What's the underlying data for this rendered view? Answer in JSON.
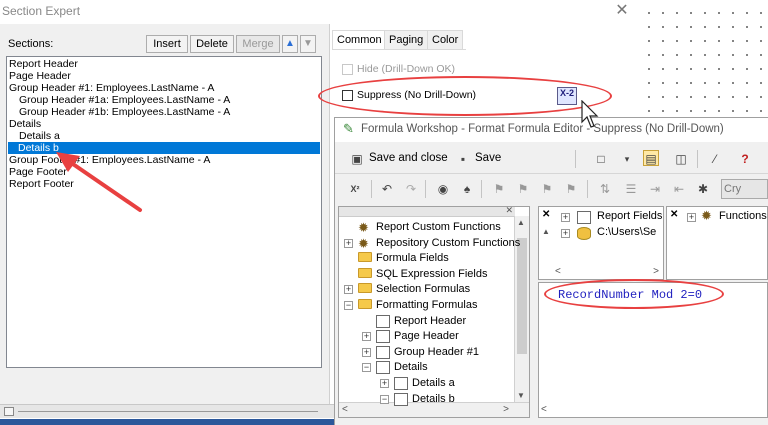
{
  "section_expert": {
    "title": "Section Expert",
    "sections_label": "Sections:",
    "buttons": {
      "insert": "Insert",
      "delete": "Delete",
      "merge": "Merge"
    },
    "sections": [
      {
        "label": "Report Header",
        "indent": 0,
        "selected": false
      },
      {
        "label": "Page Header",
        "indent": 0,
        "selected": false
      },
      {
        "label": "Group Header #1: Employees.LastName - A",
        "indent": 0,
        "selected": false
      },
      {
        "label": "Group Header #1a: Employees.LastName - A",
        "indent": 1,
        "selected": false
      },
      {
        "label": "Group Header #1b: Employees.LastName - A",
        "indent": 1,
        "selected": false
      },
      {
        "label": "Details",
        "indent": 0,
        "selected": false
      },
      {
        "label": "Details a",
        "indent": 1,
        "selected": false
      },
      {
        "label": "Details b",
        "indent": 1,
        "selected": true
      },
      {
        "label": "Group Footer #1: Employees.LastName - A",
        "indent": 0,
        "selected": false
      },
      {
        "label": "Page Footer",
        "indent": 0,
        "selected": false
      },
      {
        "label": "Report Footer",
        "indent": 0,
        "selected": false
      }
    ],
    "tabs": {
      "common": "Common",
      "paging": "Paging",
      "color": "Color"
    },
    "options": {
      "hide_label": "Hide (Drill-Down OK)",
      "suppress_label": "Suppress (No Drill-Down)",
      "formula_button": "X-2"
    }
  },
  "formula_workshop": {
    "title": "Formula Workshop - Format Formula Editor - Suppress (No Drill-Down)",
    "toolbar": {
      "save_close": "Save and close",
      "save": "Save",
      "syntax_partial": "Cry"
    },
    "tree": [
      {
        "label": "Report Custom Functions",
        "icon": "gear",
        "expander": ""
      },
      {
        "label": "Repository Custom Functions",
        "icon": "gear",
        "expander": "+"
      },
      {
        "label": "Formula Fields",
        "icon": "folder",
        "expander": ""
      },
      {
        "label": "SQL Expression Fields",
        "icon": "folder",
        "expander": ""
      },
      {
        "label": "Selection Formulas",
        "icon": "folder",
        "expander": "+"
      },
      {
        "label": "Formatting Formulas",
        "icon": "folder",
        "expander": "−"
      },
      {
        "label": "Report Header",
        "icon": "doc",
        "expander": ""
      },
      {
        "label": "Page Header",
        "icon": "doc",
        "expander": "+"
      },
      {
        "label": "Group Header #1",
        "icon": "doc",
        "expander": "+"
      },
      {
        "label": "Details",
        "icon": "doc",
        "expander": "−"
      },
      {
        "label": "Details a",
        "icon": "doc",
        "expander": "+"
      },
      {
        "label": "Details b",
        "icon": "doc",
        "expander": "−"
      }
    ],
    "fields": {
      "report_fields": "Report Fields",
      "path": "C:\\Users\\Se",
      "functions": "Functions"
    },
    "formula_text": "RecordNumber Mod 2=0"
  },
  "colors": {
    "selection": "#0078d7",
    "annotation_red": "#e84040",
    "formula_blue": "#1f1fbf"
  }
}
